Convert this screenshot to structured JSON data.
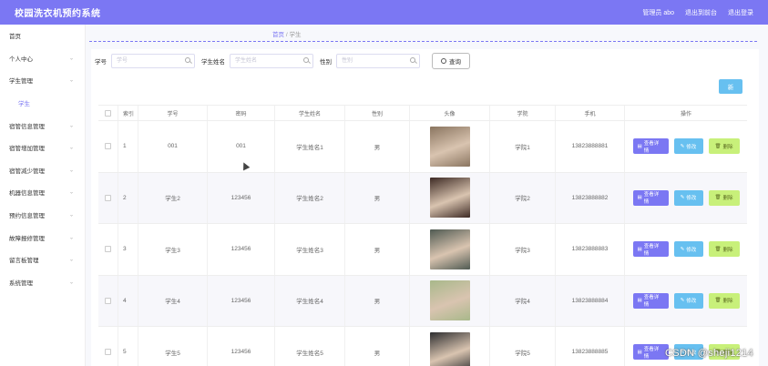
{
  "app": {
    "title": "校园洗衣机预约系统"
  },
  "header": {
    "links": [
      "管理员 abo",
      "退出到前台",
      "退出登录"
    ]
  },
  "sidebar": {
    "items": [
      {
        "label": "首页",
        "chev": false,
        "sub": false
      },
      {
        "label": "个人中心",
        "chev": true,
        "sub": false
      },
      {
        "label": "学生管理",
        "chev": true,
        "sub": false
      },
      {
        "label": "学生",
        "chev": false,
        "sub": true
      },
      {
        "label": "宿管信息管理",
        "chev": true,
        "sub": false
      },
      {
        "label": "宿管增加管理",
        "chev": true,
        "sub": false
      },
      {
        "label": "宿管减少管理",
        "chev": true,
        "sub": false
      },
      {
        "label": "机器信息管理",
        "chev": true,
        "sub": false
      },
      {
        "label": "预约信息管理",
        "chev": true,
        "sub": false
      },
      {
        "label": "故障报修管理",
        "chev": true,
        "sub": false
      },
      {
        "label": "留言板管理",
        "chev": true,
        "sub": false
      },
      {
        "label": "系统管理",
        "chev": true,
        "sub": false
      }
    ]
  },
  "breadcrumb": {
    "home": "首页",
    "separator": "/",
    "current": "学生"
  },
  "search": {
    "fields": [
      {
        "label": "学号",
        "placeholder": "学号",
        "width": 92
      },
      {
        "label": "学生姓名",
        "placeholder": "学生姓名",
        "width": 92
      },
      {
        "label": "性别",
        "placeholder": "性别",
        "width": 92
      }
    ],
    "query_label": "查询"
  },
  "add_label": "新",
  "table": {
    "headers": [
      "",
      "索引",
      "学号",
      "密码",
      "学生姓名",
      "性别",
      "头像",
      "学院",
      "手机",
      "操作"
    ],
    "rows": [
      {
        "index": "1",
        "no": "001",
        "password": "001",
        "name": "学生姓名1",
        "sex": "男",
        "college": "学院1",
        "phone": "13823888881",
        "photo_color": "#8a7560"
      },
      {
        "index": "2",
        "no": "学生2",
        "password": "123456",
        "name": "学生姓名2",
        "sex": "男",
        "college": "学院2",
        "phone": "13823888882",
        "photo_color": "#3d2a24"
      },
      {
        "index": "3",
        "no": "学生3",
        "password": "123456",
        "name": "学生姓名3",
        "sex": "男",
        "college": "学院3",
        "phone": "13823888883",
        "photo_color": "#4f5a52"
      },
      {
        "index": "4",
        "no": "学生4",
        "password": "123456",
        "name": "学生姓名4",
        "sex": "男",
        "college": "学院4",
        "phone": "13823888884",
        "photo_color": "#a8b88a"
      },
      {
        "index": "5",
        "no": "学生5",
        "password": "123456",
        "name": "学生姓名5",
        "sex": "男",
        "college": "学院5",
        "phone": "13823888885",
        "photo_color": "#2e2e30"
      }
    ],
    "ops": {
      "detail": "查看详情",
      "edit": "修改",
      "del": "删除"
    }
  },
  "watermark": "CSDN @sheji1214",
  "colors": {
    "primary": "#7b77f3",
    "edit": "#67c0f0",
    "delete": "#c8f07a"
  }
}
